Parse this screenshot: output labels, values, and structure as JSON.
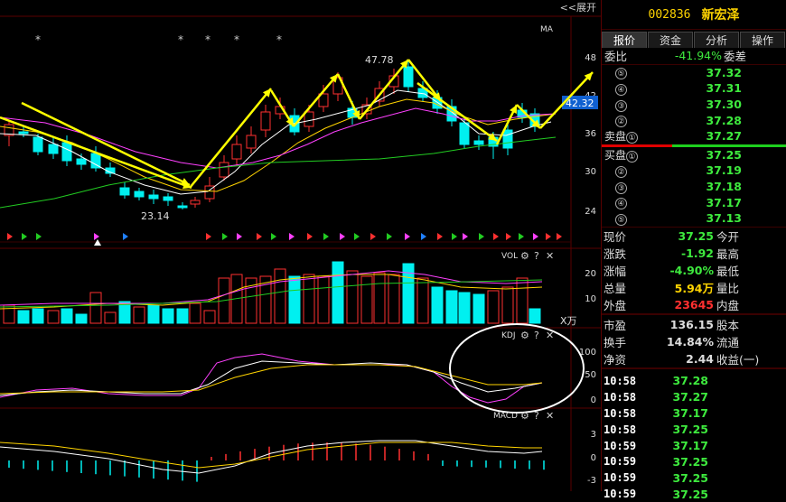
{
  "stock": {
    "code": "002836",
    "name": "新宏泽"
  },
  "chart": {
    "expand_label": "<<展开",
    "ma_label": "MA",
    "price_axis": [
      "48",
      "42",
      "36",
      "30",
      "24"
    ],
    "current_price_tag": "42.32",
    "high_label": "47.78",
    "low_label": "23.14",
    "vol_label": "VOL",
    "vol_axis": [
      "20",
      "10"
    ],
    "vol_unit": "X万",
    "kdj_label": "KDJ",
    "kdj_axis": [
      "100",
      "50",
      "0"
    ],
    "macd_label": "MACD",
    "macd_axis": [
      "3",
      "0",
      "-3"
    ],
    "help_glyph": "?",
    "close_glyph": "✕",
    "star_glyph": "*",
    "colors": {
      "up": "#ff3030",
      "down": "#00f0f0",
      "ma5": "#ffffff",
      "ma10": "#ffd400",
      "ma20": "#ff40ff",
      "ma60": "#22cc22",
      "arrow": "#ffff00"
    }
  },
  "tabs": [
    "报价",
    "资金",
    "分析",
    "操作"
  ],
  "weibi": {
    "label": "委比",
    "value": "-41.94%",
    "label2": "委差"
  },
  "sell": [
    {
      "n": "⑤",
      "price": "37.32"
    },
    {
      "n": "④",
      "price": "37.31"
    },
    {
      "n": "③",
      "price": "37.30"
    },
    {
      "n": "②",
      "price": "37.28"
    },
    {
      "n": "①",
      "price": "37.27",
      "prefix": "卖盘"
    }
  ],
  "buy": [
    {
      "n": "①",
      "price": "37.25",
      "prefix": "买盘"
    },
    {
      "n": "②",
      "price": "37.19"
    },
    {
      "n": "③",
      "price": "37.18"
    },
    {
      "n": "④",
      "price": "37.17"
    },
    {
      "n": "⑤",
      "price": "37.13"
    }
  ],
  "stats1": [
    {
      "l": "现价",
      "v": "37.25",
      "c": "green",
      "l2": "今开"
    },
    {
      "l": "涨跌",
      "v": "-1.92",
      "c": "green",
      "l2": "最高"
    },
    {
      "l": "涨幅",
      "v": "-4.90%",
      "c": "green",
      "l2": "最低"
    },
    {
      "l": "总量",
      "v": "5.94万",
      "c": "yellow",
      "l2": "量比"
    },
    {
      "l": "外盘",
      "v": "23645",
      "c": "red",
      "l2": "内盘"
    }
  ],
  "stats2": [
    {
      "l": "市盈",
      "v": "136.15",
      "c": "white",
      "l2": "股本"
    },
    {
      "l": "换手",
      "v": "14.84%",
      "c": "white",
      "l2": "流通"
    },
    {
      "l": "净资",
      "v": "2.44",
      "c": "white",
      "l2": "收益(一)"
    }
  ],
  "ticks": [
    {
      "t": "10:58",
      "p": "37.28"
    },
    {
      "t": "10:58",
      "p": "37.27"
    },
    {
      "t": "10:58",
      "p": "37.17"
    },
    {
      "t": "10:58",
      "p": "37.25"
    },
    {
      "t": "10:59",
      "p": "37.17"
    },
    {
      "t": "10:59",
      "p": "37.25"
    },
    {
      "t": "10:59",
      "p": "37.25"
    },
    {
      "t": "10:59",
      "p": "37.25"
    }
  ]
}
